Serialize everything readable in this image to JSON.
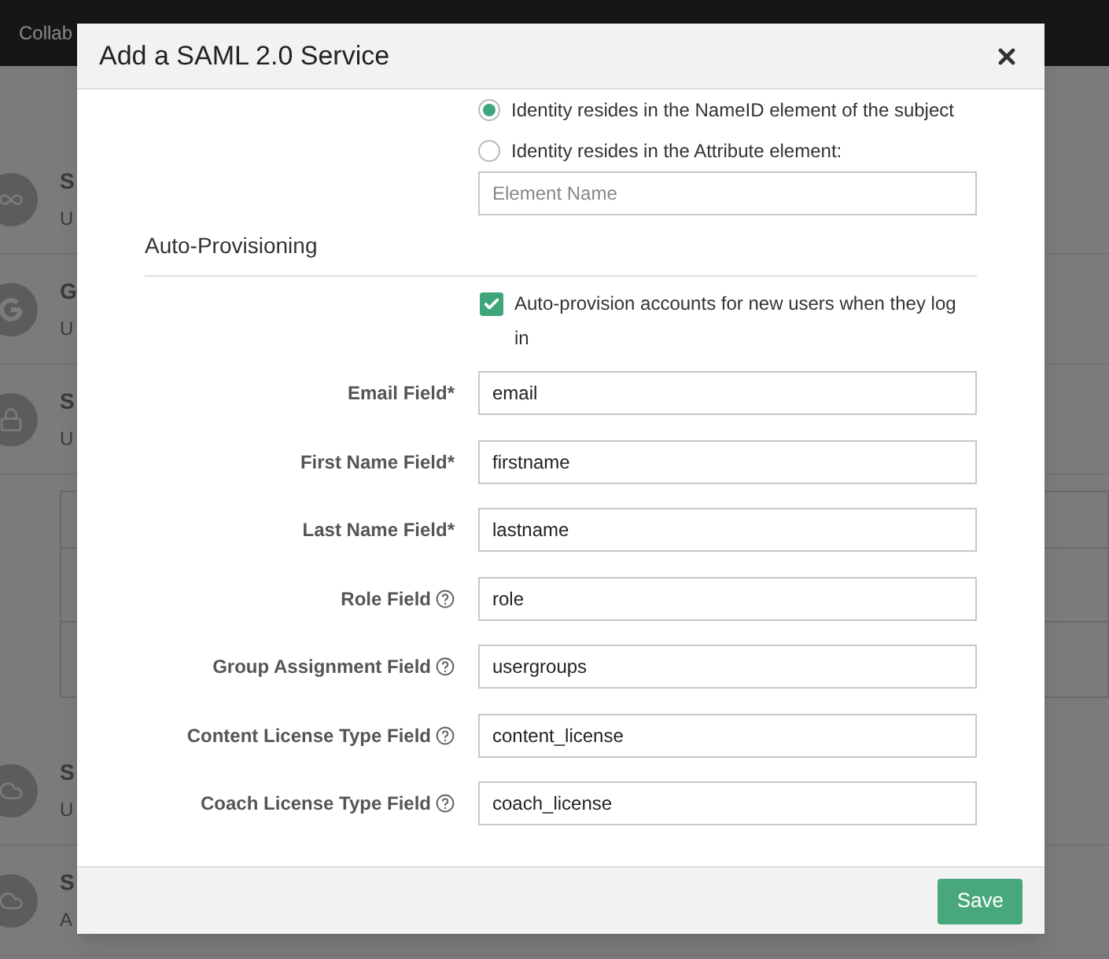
{
  "background": {
    "nav_title": "Collab",
    "items": [
      {
        "kind": "infinity",
        "title": "S",
        "subtitle": "U"
      },
      {
        "kind": "google",
        "title": "G",
        "subtitle": "U"
      },
      {
        "kind": "lock",
        "title": "S",
        "subtitle": "U"
      },
      {
        "kind": "table"
      },
      {
        "kind": "cloud",
        "title": "S",
        "subtitle": "U"
      },
      {
        "kind": "cloud",
        "title": "S",
        "subtitle": "A"
      }
    ]
  },
  "dialog": {
    "title": "Add a SAML 2.0 Service",
    "identity_options": [
      {
        "label": "Identity resides in the NameID element of the subject",
        "selected": true
      },
      {
        "label": "Identity resides in the Attribute element:",
        "selected": false
      }
    ],
    "element_name": {
      "placeholder": "Element Name"
    },
    "section": "Auto-Provisioning",
    "auto_provision": {
      "label": "Auto-provision accounts for new users when they log in",
      "checked": true
    },
    "fields": [
      {
        "label": "Email Field*",
        "help": false,
        "value": "email"
      },
      {
        "label": "First Name Field*",
        "help": false,
        "value": "firstname"
      },
      {
        "label": "Last Name Field*",
        "help": false,
        "value": "lastname"
      },
      {
        "label": "Role Field",
        "help": true,
        "value": "role"
      },
      {
        "label": "Group Assignment Field",
        "help": true,
        "value": "usergroups"
      },
      {
        "label": "Content License Type Field",
        "help": true,
        "value": "content_license"
      },
      {
        "label": "Coach License Type Field",
        "help": true,
        "value": "coach_license"
      }
    ],
    "save": "Save"
  }
}
